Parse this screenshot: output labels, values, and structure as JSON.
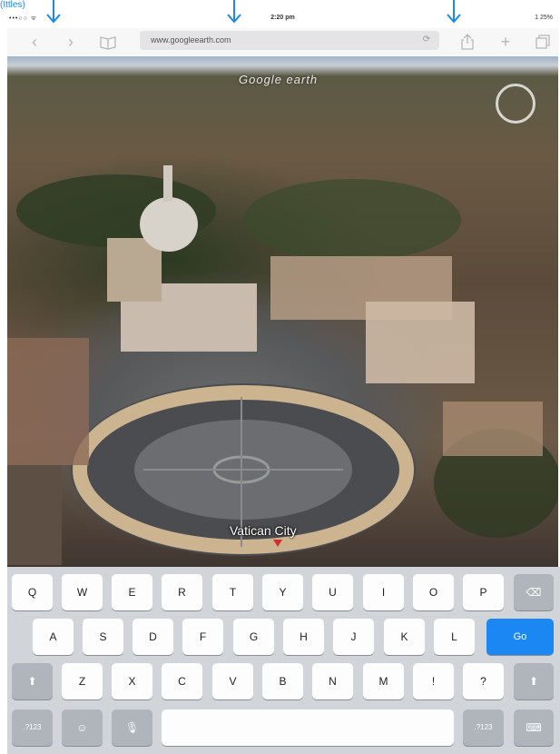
{
  "annotation": {
    "label": "(Ittles)",
    "color": "#1e88e5"
  },
  "statusbar": {
    "signal": "•••○○ ᯤ",
    "time": "2:20 pm",
    "battery": "1 25%"
  },
  "toolbar": {
    "back_icon": "chevron-left-icon",
    "forward_icon": "chevron-right-icon",
    "bookmarks_icon": "book-icon",
    "url": "www.googleearth.com",
    "reload_icon": "reload-icon",
    "share_icon": "share-icon",
    "new_tab_icon": "plus-icon",
    "tabs_icon": "tabs-icon"
  },
  "map": {
    "brand": "Google earth",
    "place_label": "Vatican City",
    "pin_color": "#d32f2f"
  },
  "keyboard": {
    "row1": [
      "Q",
      "W",
      "E",
      "R",
      "T",
      "Y",
      "U",
      "I",
      "O",
      "P"
    ],
    "row2": [
      "A",
      "S",
      "D",
      "F",
      "G",
      "H",
      "J",
      "K",
      "L"
    ],
    "row3": [
      "Z",
      "X",
      "C",
      "V",
      "B",
      "N",
      "M",
      "!",
      "?"
    ],
    "go_label": "Go",
    "numbers_label": ".?123",
    "accent_color": "#1b87f3"
  }
}
